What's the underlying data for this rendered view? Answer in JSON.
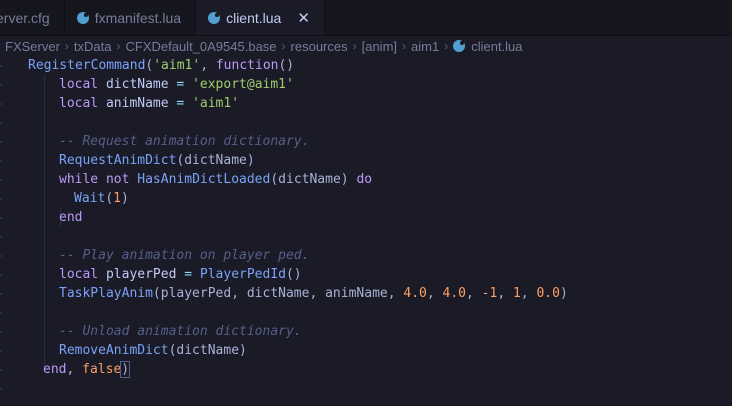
{
  "tabs": [
    {
      "label": "erver.cfg",
      "active": false,
      "icon": "gear-icon"
    },
    {
      "label": "fxmanifest.lua",
      "active": false,
      "icon": "lua-icon"
    },
    {
      "label": "client.lua",
      "active": true,
      "icon": "lua-icon",
      "close": "✕"
    }
  ],
  "breadcrumb": [
    "FXServer",
    "txData",
    "CFXDefault_0A9545.base",
    "resources",
    "[anim]",
    "aim1",
    "client.lua"
  ],
  "breadcrumb_sep": "›",
  "code": {
    "l1": {
      "a": "RegisterCommand",
      "b": "(",
      "c": "'aim1'",
      "d": ", ",
      "e": "function",
      "f": "()"
    },
    "l2": {
      "a": "local",
      "b": " dictName ",
      "c": "=",
      "d": " ",
      "e": "'export@aim1'"
    },
    "l3": {
      "a": "local",
      "b": " animName ",
      "c": "=",
      "d": " ",
      "e": "'aim1'"
    },
    "l5": "-- Request animation dictionary.",
    "l6": {
      "a": "RequestAnimDict",
      "b": "(dictName)"
    },
    "l7": {
      "a": "while",
      "b": " ",
      "c": "not",
      "d": " ",
      "e": "HasAnimDictLoaded",
      "f": "(dictName) ",
      "g": "do"
    },
    "l8": {
      "a": "Wait",
      "b": "(",
      "c": "1",
      "d": ")"
    },
    "l9": "end",
    "l11": "-- Play animation on player ped.",
    "l12": {
      "a": "local",
      "b": " playerPed ",
      "c": "=",
      "d": " ",
      "e": "PlayerPedId",
      "f": "()"
    },
    "l13": {
      "a": "TaskPlayAnim",
      "b": "(playerPed, dictName, animName, ",
      "c": "4.0",
      "d": ", ",
      "e": "4.0",
      "f": ", ",
      "g": "-1",
      "h": ", ",
      "i": "1",
      "j": ", ",
      "k": "0.0",
      "l": ")"
    },
    "l15": "-- Unload animation dictionary.",
    "l16": {
      "a": "RemoveAnimDict",
      "b": "(dictName)"
    },
    "l17": {
      "a": "end",
      "b": ", ",
      "c": "false",
      "d": ")"
    }
  },
  "theme": {
    "background": "#1a1b26",
    "keyword": "#bb9af7",
    "function": "#7aa2f7",
    "string": "#9ece6a",
    "number": "#ff9e64",
    "comment": "#565f89"
  }
}
